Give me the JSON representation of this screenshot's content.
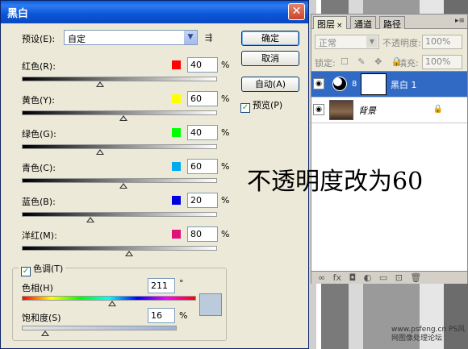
{
  "dialog": {
    "title": "黑白",
    "close_glyph": "✕",
    "preset_label": "预设(E):",
    "preset_value": "自定",
    "preset_arrow": "▼",
    "preset_menu_icon": "⇶",
    "buttons": {
      "ok": "确定",
      "cancel": "取消",
      "auto": "自动(A)"
    },
    "preview": {
      "label": "预览(P)",
      "checked": true,
      "check_glyph": "✓"
    },
    "channels": [
      {
        "label": "红色(R):",
        "value": "40",
        "unit": "%",
        "color": "#ff0000",
        "slider": 0.4
      },
      {
        "label": "黄色(Y):",
        "value": "60",
        "unit": "%",
        "color": "#ffff00",
        "slider": 0.52
      },
      {
        "label": "绿色(G):",
        "value": "40",
        "unit": "%",
        "color": "#00ff00",
        "slider": 0.4
      },
      {
        "label": "青色(C):",
        "value": "60",
        "unit": "%",
        "color": "#00aaee",
        "slider": 0.52
      },
      {
        "label": "蓝色(B):",
        "value": "20",
        "unit": "%",
        "color": "#0000dd",
        "slider": 0.35
      },
      {
        "label": "洋红(M):",
        "value": "80",
        "unit": "%",
        "color": "#e0107a",
        "slider": 0.55
      }
    ],
    "tint": {
      "label": "色调(T)",
      "checked": true,
      "hue_label": "色相(H)",
      "hue_value": "211",
      "hue_unit": "°",
      "hue_slider": 0.52,
      "saturation_label": "饱和度(S)",
      "saturation_value": "16",
      "saturation_unit": "%",
      "saturation_slider": 0.15,
      "swatch_color": "#bccbdc"
    }
  },
  "layers_panel": {
    "tabs": [
      {
        "label": "图层",
        "close": "×"
      },
      {
        "label": "通道"
      },
      {
        "label": "路径"
      }
    ],
    "menu_icon": "▸≡",
    "blend_mode": "正常",
    "blend_arrow": "▼",
    "opacity_label": "不透明度:",
    "opacity_value": "100%",
    "lock_label": "锁定:",
    "lock_icons": "☐ ✎ ✥ 🔒",
    "fill_label": "填充:",
    "fill_value": "100%",
    "layers": [
      {
        "name": "黑白 1",
        "selected": true,
        "eye": "◉",
        "chain": "8"
      },
      {
        "name": "背景",
        "selected": false,
        "eye": "◉",
        "lock": "🔒"
      }
    ],
    "footer": "∞ fx ◘ ◐ ▭ ⊡ 🗑"
  },
  "annotation": "不透明度改为60",
  "watermark": "www.psfeng.cn PS风网图像处理论坛"
}
